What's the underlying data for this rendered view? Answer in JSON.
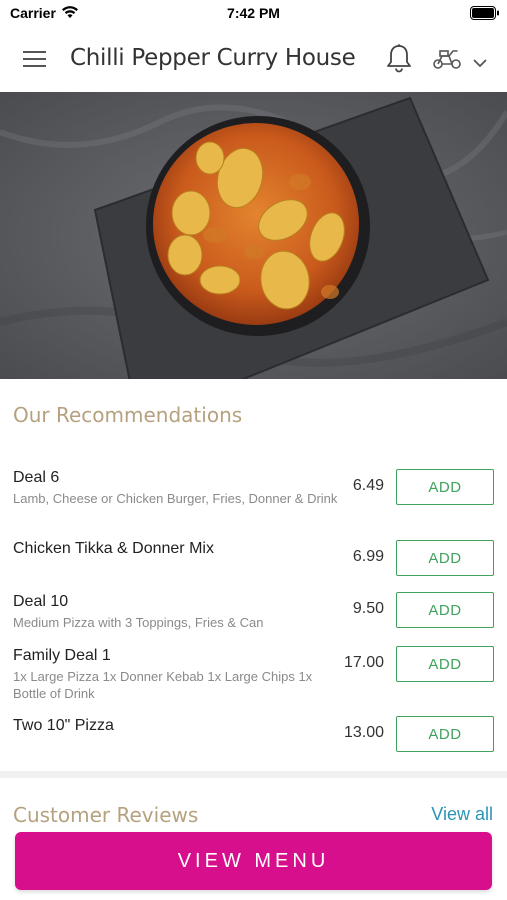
{
  "status_bar": {
    "carrier": "Carrier",
    "time": "7:42 PM"
  },
  "header": {
    "title": "Chilli Pepper Curry House"
  },
  "recommendations": {
    "title": "Our Recommendations",
    "add_label": "ADD",
    "items": [
      {
        "name": "Deal 6",
        "description": "Lamb, Cheese or Chicken Burger, Fries, Donner & Drink",
        "price": "6.49"
      },
      {
        "name": "Chicken Tikka & Donner Mix",
        "description": "",
        "price": "6.99"
      },
      {
        "name": "Deal 10",
        "description": "Medium Pizza with 3 Toppings, Fries & Can",
        "price": "9.50"
      },
      {
        "name": "Family Deal 1",
        "description": "1x Large Pizza 1x Donner Kebab 1x Large Chips 1x Bottle of Drink",
        "price": "17.00"
      },
      {
        "name": "Two 10\" Pizza",
        "description": "",
        "price": "13.00"
      }
    ]
  },
  "reviews": {
    "title": "Customer Reviews",
    "view_all": "View all"
  },
  "footer": {
    "view_menu": "VIEW MENU"
  },
  "colors": {
    "accent": "#d80f8d",
    "add_green": "#3fa25d",
    "section_gold": "#b6a17f",
    "link_blue": "#2b94b5"
  }
}
